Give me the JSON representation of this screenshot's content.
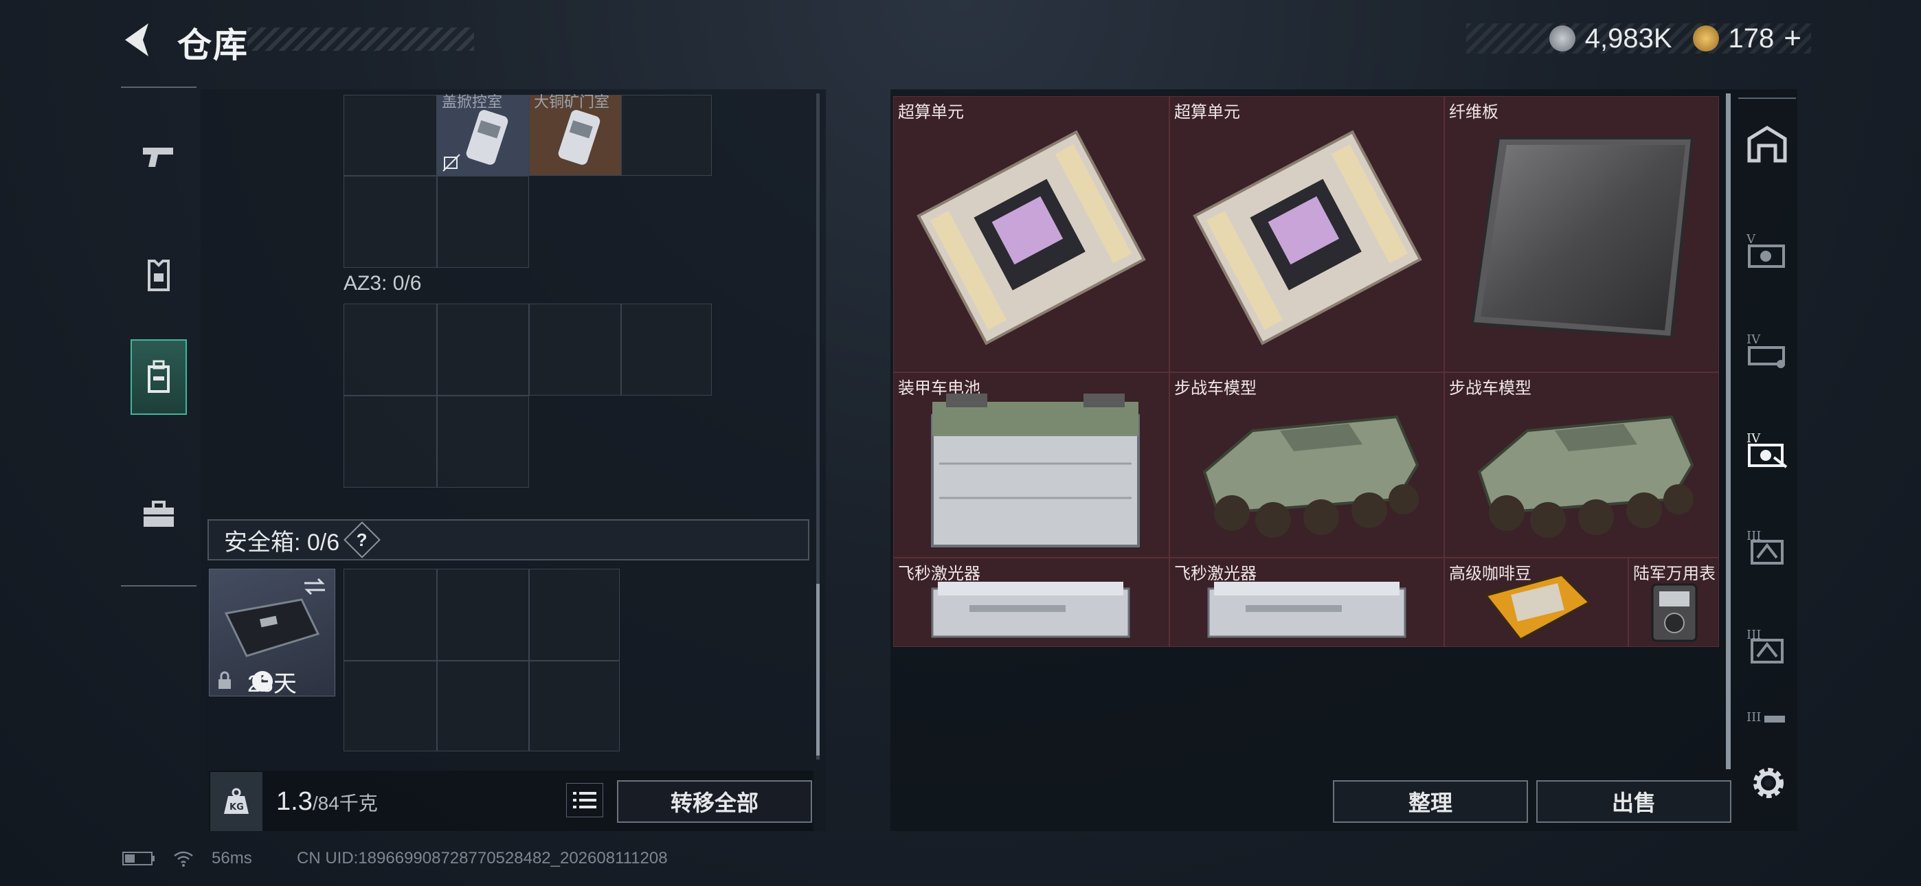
{
  "header": {
    "title": "仓库"
  },
  "currency": {
    "silver": "4,983K",
    "gold": "178",
    "add": "+"
  },
  "inventory": {
    "partial_labels": [
      "盖掀控室",
      "大铜矿门室"
    ],
    "az3_label": "AZ3: 0/6",
    "safebox_label": "安全箱: 0/6",
    "help": "?",
    "case_days": "23天",
    "weight_current": "1.3",
    "weight_max": "/84千克",
    "transfer_all": "转移全部"
  },
  "stash": {
    "items": [
      {
        "name": "超算单元",
        "icon": "supercomputer-unit-icon"
      },
      {
        "name": "超算单元",
        "icon": "supercomputer-unit-icon"
      },
      {
        "name": "纤维板",
        "icon": "fiberboard-icon"
      },
      {
        "name": "装甲车电池",
        "icon": "armored-vehicle-battery-icon"
      },
      {
        "name": "步战车模型",
        "icon": "ifv-model-icon"
      },
      {
        "name": "步战车模型",
        "icon": "ifv-model-icon"
      },
      {
        "name": "飞秒激光器",
        "icon": "femtosecond-laser-icon"
      },
      {
        "name": "飞秒激光器",
        "icon": "femtosecond-laser-icon"
      },
      {
        "name": "高级咖啡豆",
        "icon": "coffee-beans-icon"
      },
      {
        "name": "陆军万用表",
        "icon": "multimeter-icon"
      }
    ],
    "sort": "整理",
    "sell": "出售",
    "categories": [
      "vault",
      "V",
      "IV",
      "IV",
      "III",
      "III",
      "III"
    ]
  },
  "status": {
    "ping": "56ms",
    "uid": "CN UID:189669908728770528482_202608111208"
  },
  "colors": {
    "accent": "#3fb89a",
    "item_bg": "#3b2128"
  }
}
